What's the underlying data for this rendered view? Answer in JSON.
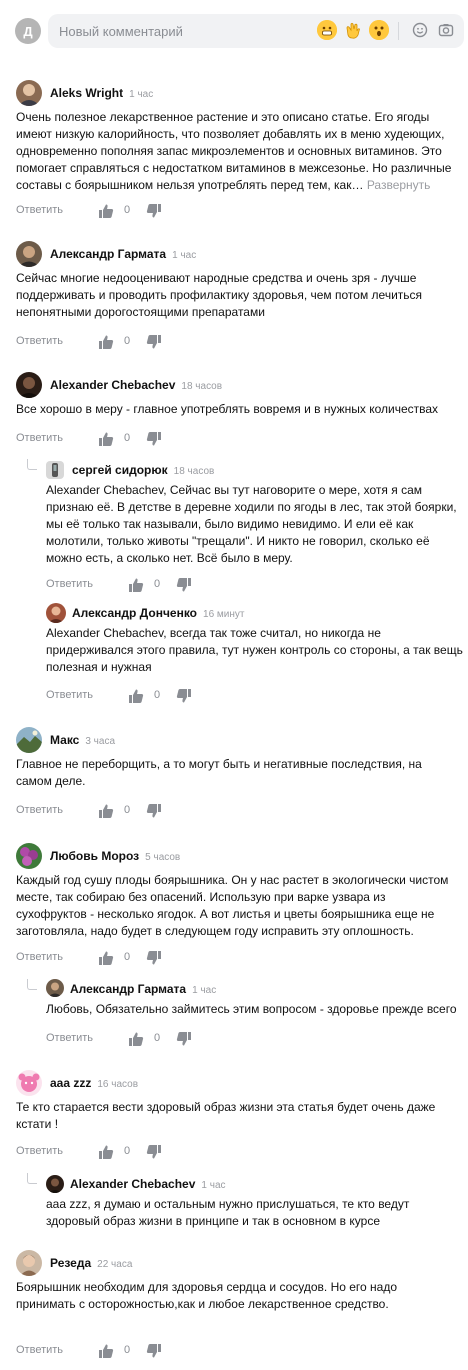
{
  "composer": {
    "avatar_letter": "Д",
    "placeholder": "Новый комментарий"
  },
  "comments": [
    {
      "author": "Aleks Wright",
      "time": "1 час",
      "text": "Очень полезное лекарственное растение и это описано статье. Его ягоды имеют низкую калорийность, что позволяет добавлять их в меню худеющих, одновременно пополняя запас микроэлементов и основных витаминов. Это помогает справляться с недостатком витаминов в межсезонье. Но различные составы с боярышником нельзя употреблять перед тем, как…",
      "expand": "Развернуть",
      "reply": "Ответить",
      "likes": "0"
    },
    {
      "author": "Александр Гармата",
      "time": "1 час",
      "text": "Сейчас многие недооценивают народные средства и очень зря - лучше поддерживать и проводить профилактику здоровья, чем потом лечиться непонятными дорогостоящими препаратами",
      "reply": "Ответить",
      "likes": "0"
    },
    {
      "author": "Alexander Chebachev",
      "time": "18 часов",
      "text": "Все хорошо в меру - главное употреблять вовремя и в нужных количествах",
      "reply": "Ответить",
      "likes": "0"
    },
    {
      "author": "сергей сидорюк",
      "time": "18 часов",
      "text": "Alexander Chebachev, Сейчас вы тут наговорите о мере, хотя я сам признаю её. В детстве в деревне ходили по ягоды в лес, так этой боярки, мы её только так называли, было видимо невидимо. И ели её как молотили, только животы \"трещали\". И никто не говорил, сколько её можно есть, а сколько нет. Всё было в меру.",
      "reply": "Ответить",
      "likes": "0"
    },
    {
      "author": "Александр Донченко",
      "time": "16 минут",
      "text": "Alexander Chebachev, всегда так тоже считал, но никогда не придерживался этого правила, тут нужен контроль со стороны, а так вещь полезная и нужная",
      "reply": "Ответить",
      "likes": "0"
    },
    {
      "author": "Макс",
      "time": "3 часа",
      "text": "Главное не переборщить, а то могут быть и негативные последствия, на самом деле.",
      "reply": "Ответить",
      "likes": "0"
    },
    {
      "author": "Любовь Мороз",
      "time": "5 часов",
      "text": "Каждый год сушу плоды боярышника. Он у нас растет в экологически чистом месте, так собираю без опасений. Использую при варке узвара из сухофруктов - несколько ягодок. А вот листья и цветы боярышника еще не заготовляла, надо будет в следующем году исправить эту оплошность.",
      "reply": "Ответить",
      "likes": "0"
    },
    {
      "author": "Александр Гармата",
      "time": "1 час",
      "text": "Любовь, Обязательно займитесь этим вопросом - здоровье прежде всего",
      "reply": "Ответить",
      "likes": "0"
    },
    {
      "author": "aaa zzz",
      "time": "16 часов",
      "text": "Те кто старается вести здоровый образ жизни эта статья будет очень даже кстати !",
      "reply": "Ответить",
      "likes": "0"
    },
    {
      "author": "Alexander Chebachev",
      "time": "1 час",
      "text": "aaa zzz, я думаю и остальным нужно прислушаться, те кто ведут здоровый образ жизни в принципе и так в основном в курсе",
      "reply": "Ответить",
      "likes": "0"
    },
    {
      "author": "Резеда",
      "time": "22 часа",
      "text": "Боярышник необходим для здоровья сердца и сосудов. Но его надо принимать с осторожностью,как и любое лекарственное средство.",
      "reply": "Ответить",
      "likes": "0"
    }
  ]
}
